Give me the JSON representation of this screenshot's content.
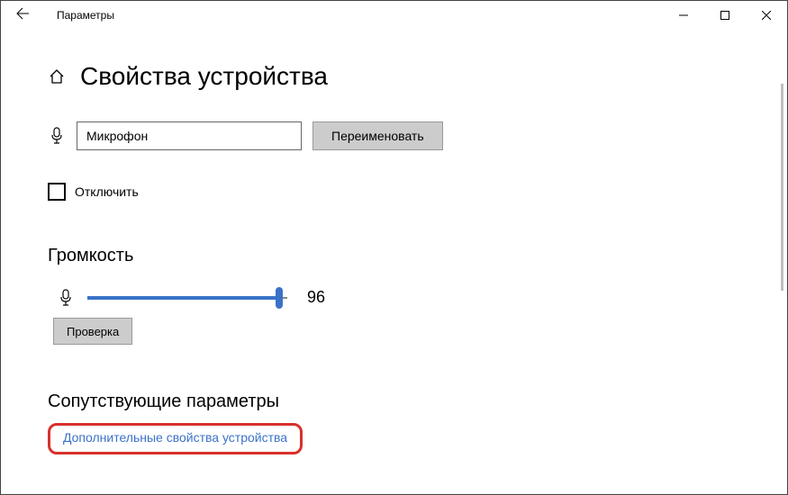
{
  "titlebar": {
    "app_name": "Параметры"
  },
  "header": {
    "title": "Свойства устройства"
  },
  "device": {
    "name_value": "Микрофон",
    "rename_label": "Переименовать"
  },
  "disable": {
    "label": "Отключить",
    "checked": false
  },
  "volume": {
    "heading": "Громкость",
    "value": 96,
    "test_label": "Проверка"
  },
  "related": {
    "heading": "Сопутствующие параметры",
    "link_label": "Дополнительные свойства устройства"
  }
}
